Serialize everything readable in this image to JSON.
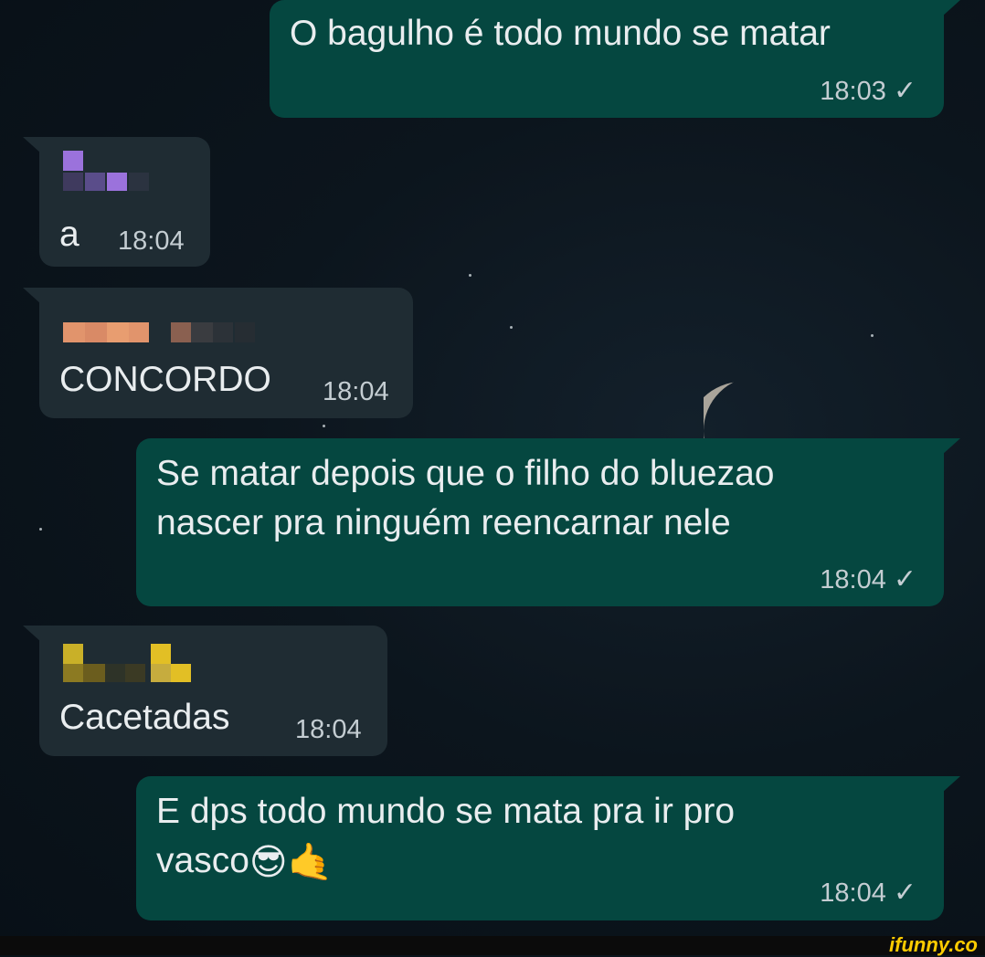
{
  "messages": [
    {
      "id": "m1",
      "direction": "outgoing",
      "text": "O bagulho é todo mundo se matar",
      "time": "18:03",
      "status": "✓"
    },
    {
      "id": "m2",
      "direction": "incoming",
      "sender_colors": [
        "#9b72dc",
        "#5a4d8a",
        "#9b72dc"
      ],
      "text": "a",
      "time": "18:04"
    },
    {
      "id": "m3",
      "direction": "incoming",
      "sender_colors": [
        "#e1946c",
        "#8a6050"
      ],
      "text": "CONCORDO",
      "time": "18:04"
    },
    {
      "id": "m4",
      "direction": "outgoing",
      "text": "Se matar depois que o filho do bluezao\nnascer pra ninguém reencarnar nele",
      "time": "18:04",
      "status": "✓"
    },
    {
      "id": "m5",
      "direction": "incoming",
      "sender_colors": [
        "#c9b028",
        "#6b5d1e",
        "#e2bf25"
      ],
      "text": "Cacetadas",
      "time": "18:04"
    },
    {
      "id": "m6",
      "direction": "outgoing",
      "text": "E dps todo mundo se mata pra ir pro\nvasco",
      "emojis": "😎🤙",
      "time": "18:04",
      "status": "✓"
    }
  ],
  "watermark": "ifunny.co",
  "colors": {
    "outgoing_bubble": "#054740",
    "incoming_bubble": "#1f2c33",
    "background": "#0c151d"
  }
}
